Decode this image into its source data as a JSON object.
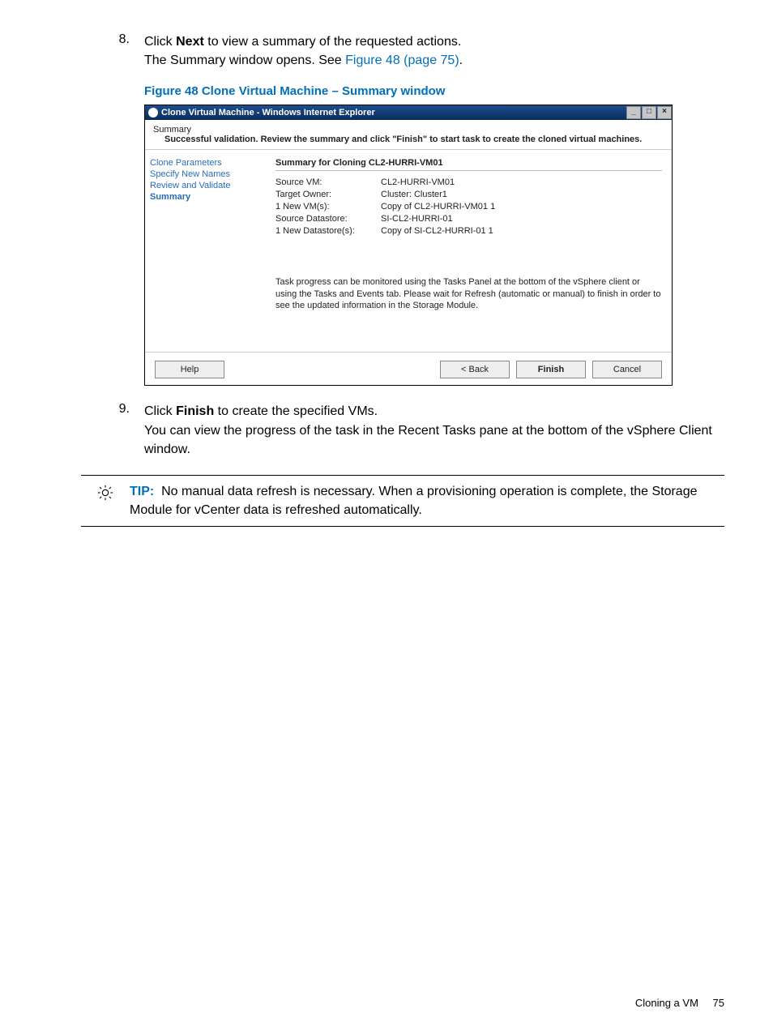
{
  "steps": {
    "s8": {
      "num": "8.",
      "line1_pre": "Click ",
      "line1_bold": "Next",
      "line1_post": " to view a summary of the requested actions.",
      "line2_pre": "The Summary window opens. See ",
      "line2_link": "Figure 48 (page 75)",
      "line2_post": "."
    },
    "s9": {
      "num": "9.",
      "line1_pre": "Click ",
      "line1_bold": "Finish",
      "line1_post": " to create the specified VMs.",
      "line2": "You can view the progress of the task in the Recent Tasks pane at the bottom of the vSphere Client window."
    }
  },
  "figure_caption": "Figure 48 Clone Virtual Machine – Summary window",
  "window": {
    "title": "Clone Virtual Machine - Windows Internet Explorer",
    "sys": {
      "min": "_",
      "max": "□",
      "close": "×"
    },
    "header_l1": "Summary",
    "header_l2": "Successful validation. Review the summary and click \"Finish\" to start task to create the cloned virtual machines.",
    "nav": {
      "n1": "Clone Parameters",
      "n2": "Specify New Names",
      "n3": "Review and Validate",
      "n4": "Summary"
    },
    "main_head": "Summary for Cloning CL2-HURRI-VM01",
    "rows": [
      {
        "k": "Source VM:",
        "v": "CL2-HURRI-VM01"
      },
      {
        "k": "Target Owner:",
        "v": "Cluster: Cluster1"
      },
      {
        "k": "1  New VM(s):",
        "v": "Copy of CL2-HURRI-VM01 1"
      },
      {
        "k": "Source Datastore:",
        "v": "SI-CL2-HURRI-01"
      },
      {
        "k": "1  New Datastore(s):",
        "v": "Copy of SI-CL2-HURRI-01 1"
      }
    ],
    "note": "Task progress can be monitored using the Tasks Panel at the bottom of the vSphere client or using the Tasks and Events tab. Please wait for Refresh (automatic or manual) to finish in order to see the updated information in the Storage Module.",
    "buttons": {
      "help": "Help",
      "back": "< Back",
      "finish": "Finish",
      "cancel": "Cancel"
    }
  },
  "tip": {
    "label": "TIP:",
    "body": "No manual data refresh is necessary. When a provisioning operation is complete, the Storage Module for vCenter data is refreshed automatically."
  },
  "footer": {
    "section": "Cloning a VM",
    "page": "75"
  }
}
